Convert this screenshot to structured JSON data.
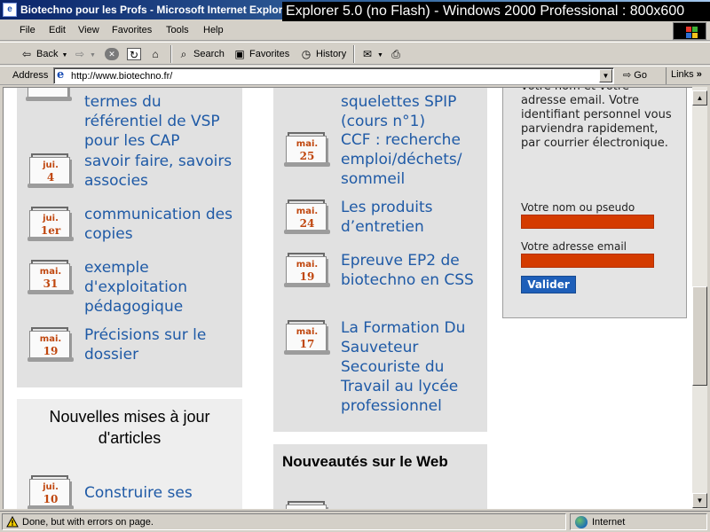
{
  "window": {
    "title": "Biotechno pour les Profs - Microsoft Internet Explorer",
    "overlay": "Explorer 5.0 (no Flash) - Windows 2000 Professional : 800x600"
  },
  "menu": [
    "File",
    "Edit",
    "View",
    "Favorites",
    "Tools",
    "Help"
  ],
  "toolbar": {
    "back": "Back",
    "search": "Search",
    "favorites": "Favorites",
    "history": "History"
  },
  "address": {
    "label": "Address",
    "url": "http://www.biotechno.fr/",
    "go": "Go",
    "links": "Links"
  },
  "left_column": {
    "entries": [
      {
        "month": "",
        "day": "",
        "text": "termes du référentiel de VSP pour les CAP"
      },
      {
        "month": "jui.",
        "day": "4",
        "text": "savoir faire, savoirs associes"
      },
      {
        "month": "jui.",
        "day": "1er",
        "text": "communication des copies"
      },
      {
        "month": "mai.",
        "day": "31",
        "text": "exemple d'exploitation pédagogique"
      },
      {
        "month": "mai.",
        "day": "19",
        "text": "Précisions sur le dossier"
      }
    ],
    "section2_title": "Nouvelles mises à jour d'articles",
    "section2_entries": [
      {
        "month": "jui.",
        "day": "10",
        "text": "Construire ses"
      }
    ]
  },
  "middle_column": {
    "entries": [
      {
        "month": "",
        "day": "",
        "text": "squelettes SPIP (cours n°1)"
      },
      {
        "month": "mai.",
        "day": "25",
        "text": "CCF : recherche emploi/déchets/ sommeil"
      },
      {
        "month": "mai.",
        "day": "24",
        "text": "Les produits d’entretien"
      },
      {
        "month": "mai.",
        "day": "19",
        "text": "Epreuve EP2 de biotechno en CSS"
      },
      {
        "month": "mai.",
        "day": "17",
        "text": "La Formation Du Sauveteur Secouriste du Travail au lycée professionnel"
      }
    ],
    "section2_title": "Nouveautés sur le Web"
  },
  "sidebar": {
    "intro": "votre nom et votre adresse email. Votre identifiant personnel vous parviendra rapidement, par courrier électronique.",
    "name_label": "Votre nom ou pseudo",
    "email_label": "Votre adresse email",
    "submit": "Valider",
    "input_color": "#d43b00"
  },
  "status": {
    "text": "Done, but with errors on page.",
    "zone": "Internet"
  }
}
